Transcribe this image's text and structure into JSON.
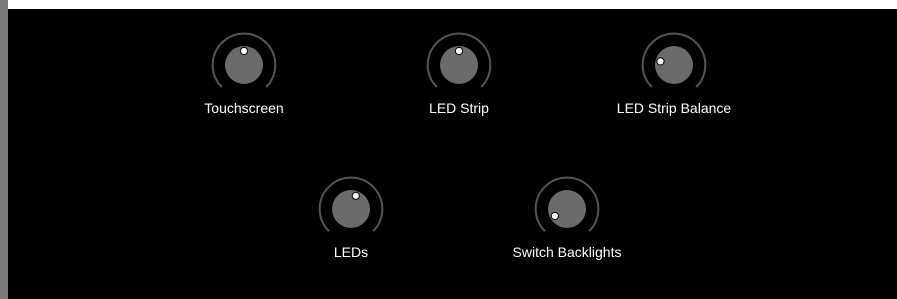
{
  "colors": {
    "background": "#000000",
    "sidebar": "#7b7b7b",
    "knob_body": "#6b6b6b",
    "knob_ring": "#555555",
    "indicator": "#ffffff",
    "label": "#ffffff"
  },
  "knobs": [
    {
      "id": "touchscreen",
      "label": "Touchscreen",
      "indicator_angle_deg": 0
    },
    {
      "id": "led-strip",
      "label": "LED Strip",
      "indicator_angle_deg": 0
    },
    {
      "id": "led-strip-balance",
      "label": "LED Strip Balance",
      "indicator_angle_deg": -75
    },
    {
      "id": "leds",
      "label": "LEDs",
      "indicator_angle_deg": 20
    },
    {
      "id": "switch-backlights",
      "label": "Switch Backlights",
      "indicator_angle_deg": -120
    }
  ]
}
